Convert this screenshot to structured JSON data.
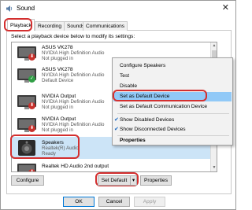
{
  "window": {
    "title": "Sound",
    "close_glyph": "✕"
  },
  "tabs": [
    {
      "label": "Playback",
      "active": true
    },
    {
      "label": "Recording"
    },
    {
      "label": "Sounds"
    },
    {
      "label": "Communications"
    }
  ],
  "instruction": "Select a playback device below to modify its settings:",
  "devices": [
    {
      "name": "ASUS VK278",
      "desc": "NVIDIA High Definition Audio",
      "status": "Not plugged in",
      "icon": "monitor-icon",
      "badge": "unplugged-red-badge"
    },
    {
      "name": "ASUS VK278",
      "desc": "NVIDIA High Definition Audio",
      "status": "Default Device",
      "icon": "monitor-icon",
      "badge": "default-green-check-badge"
    },
    {
      "name": "NVIDIA Output",
      "desc": "NVIDIA High Definition Audio",
      "status": "Not plugged in",
      "icon": "monitor-icon",
      "badge": "unplugged-red-badge"
    },
    {
      "name": "NVIDIA Output",
      "desc": "NVIDIA High Definition Audio",
      "status": "Not plugged in",
      "icon": "monitor-icon",
      "badge": "unplugged-red-badge"
    },
    {
      "name": "Speakers",
      "desc": "Realtek(R) Audio",
      "status": "Ready",
      "icon": "speaker-icon",
      "selected": true
    },
    {
      "name": "Realtek HD Audio 2nd output",
      "desc": "",
      "status": "",
      "icon": "monitor-icon",
      "badge": "unplugged-red-badge"
    }
  ],
  "badges": {
    "unplugged": "⬇",
    "default": "✓"
  },
  "buttons": {
    "configure": "Configure",
    "set_default": "Set Default",
    "set_default_arrow": "▾",
    "properties": "Properties",
    "ok": "OK",
    "cancel": "Cancel",
    "apply": "Apply"
  },
  "context_menu": {
    "items": [
      {
        "label": "Configure Speakers"
      },
      {
        "label": "Test"
      },
      {
        "label": "Disable"
      },
      {
        "label": "Set as Default Device",
        "highlight": true
      },
      {
        "label": "Set as Default Communication Device"
      },
      {
        "label": "Show Disabled Devices",
        "checked": true
      },
      {
        "label": "Show Disconnected Devices",
        "checked": true
      },
      {
        "label": "Properties",
        "bold": true
      }
    ],
    "check_glyph": "✔"
  },
  "scroll": {
    "up": "▲",
    "down": "▼"
  },
  "colors": {
    "highlight_ring": "#d32f2f",
    "selection": "#cce4f7",
    "menu_highlight": "#91c9f7",
    "default_border": "#0078d7"
  }
}
